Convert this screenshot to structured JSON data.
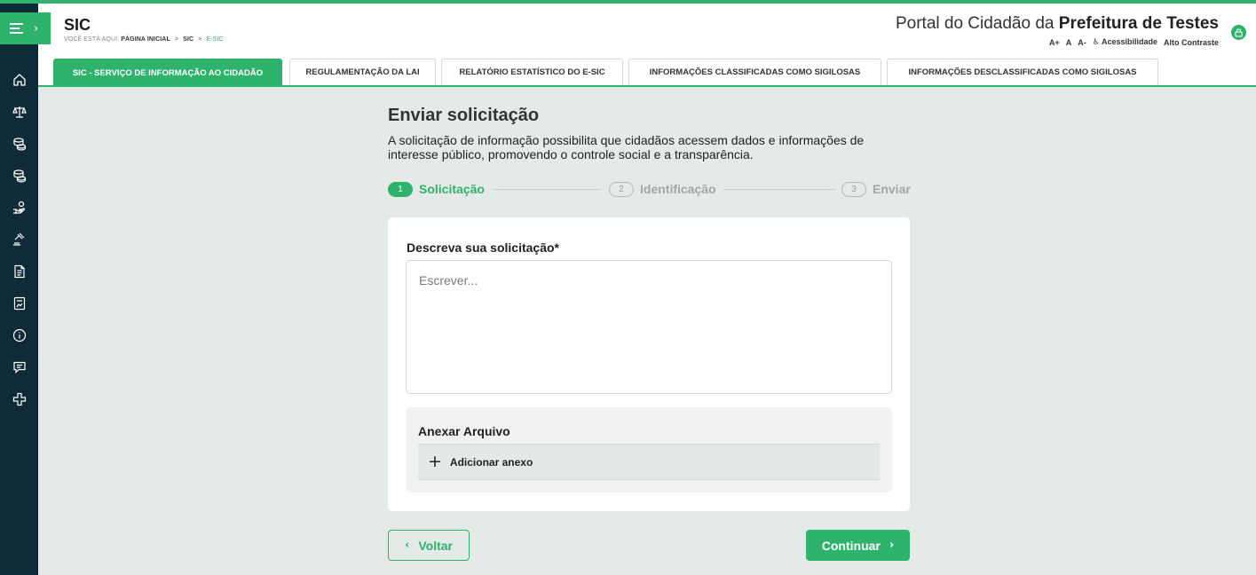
{
  "colors": {
    "brand": "#2fb26b",
    "sidebar": "#0f2b38",
    "background": "#e4eae8"
  },
  "header": {
    "app_title": "SIC",
    "breadcrumb": {
      "prefix": "VOCÊ ESTÁ AQUI:",
      "items": [
        "PÁGINA INICIAL",
        "SIC",
        "E-SIC"
      ],
      "separator": ">"
    },
    "portal_prefix": "Portal do Cidadão da",
    "portal_name": "Prefeitura de Testes",
    "accessibility": {
      "increase_font": "A+",
      "normal_font": "A",
      "decrease_font": "A-",
      "accessibility_label": "Acessibilidade",
      "contrast_label": "Alto Contraste"
    }
  },
  "sidebar": {
    "icons": [
      "home-icon",
      "scales-icon",
      "coins-icon",
      "coins-stack-icon",
      "money-hand-icon",
      "gavel-icon",
      "document-icon",
      "report-icon",
      "info-coin-icon",
      "chat-icon",
      "health-cross-icon"
    ]
  },
  "tabs": [
    {
      "label": "SIC - SERVIÇO DE INFORMAÇÃO AO CIDADÃO",
      "active": true
    },
    {
      "label": "REGULAMENTAÇÃO DA LAI",
      "active": false
    },
    {
      "label": "RELATÓRIO ESTATÍSTICO DO E-SIC",
      "active": false
    },
    {
      "label": "INFORMAÇÕES CLASSIFICADAS COMO SIGILOSAS",
      "active": false
    },
    {
      "label": "INFORMAÇÕES DESCLASSIFICADAS COMO SIGILOSAS",
      "active": false
    }
  ],
  "main": {
    "title": "Enviar solicitação",
    "description": "A solicitação de informação possibilita que cidadãos acessem dados e informações de interesse público, promovendo o controle social e a transparência.",
    "steps": [
      {
        "number": "1",
        "label": "Solicitação",
        "active": true
      },
      {
        "number": "2",
        "label": "Identificação",
        "active": false
      },
      {
        "number": "3",
        "label": "Enviar",
        "active": false
      }
    ],
    "form": {
      "field_label": "Descreva sua solicitação*",
      "field_placeholder": "Escrever...",
      "field_value": "",
      "attach_title": "Anexar Arquivo",
      "attach_add": "Adicionar anexo"
    },
    "back_label": "Voltar",
    "continue_label": "Continuar"
  }
}
